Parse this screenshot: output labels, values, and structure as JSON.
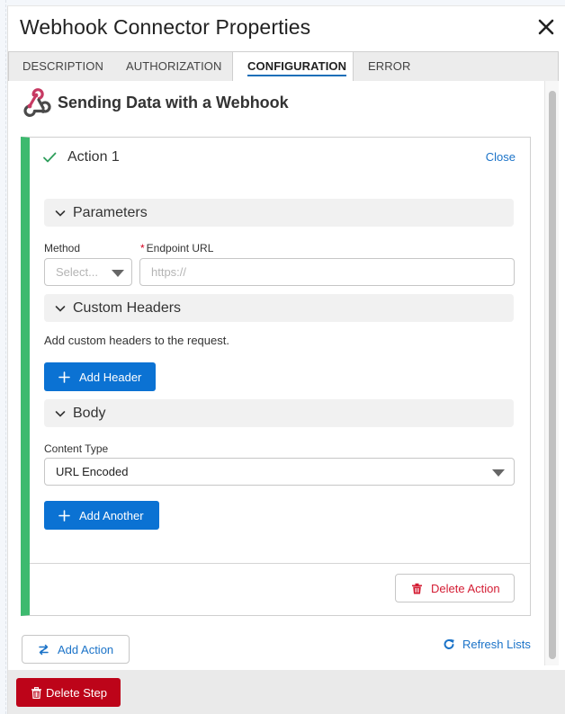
{
  "dialog": {
    "title": "Webhook Connector Properties",
    "close_label": "×"
  },
  "tabs": [
    {
      "label": "DESCRIPTION",
      "active": false
    },
    {
      "label": "AUTHORIZATION",
      "active": false
    },
    {
      "label": "CONFIGURATION",
      "active": true
    },
    {
      "label": "ERROR HANDLING",
      "active": false
    }
  ],
  "section": {
    "title": "Sending Data with a Webhook",
    "icon": "webhook-icon"
  },
  "action": {
    "title": "Action 1",
    "status_icon": "check-icon",
    "close_label": "Close",
    "parameters": {
      "header": "Parameters",
      "method_label": "Method",
      "method_placeholder": "Select...",
      "endpoint_label": "Endpoint URL",
      "endpoint_required": "*",
      "endpoint_placeholder": "https://"
    },
    "custom_headers": {
      "header": "Custom Headers",
      "help": "Add custom headers to the request.",
      "add_button": "Add Header"
    },
    "body": {
      "header": "Body",
      "content_type_label": "Content Type",
      "content_type_value": "URL Encoded",
      "add_button": "Add Another"
    },
    "delete_button": "Delete Action"
  },
  "bottom": {
    "add_action": "Add Action",
    "refresh_lists": "Refresh Lists"
  },
  "footer": {
    "delete_step": "Delete Step"
  },
  "colors": {
    "accent_blue": "#0b72d3",
    "link_blue": "#1b73c8",
    "success_green": "#3dba6f",
    "danger_red": "#d41d34",
    "delete_step_red": "#bd0419",
    "webhook_pink": "#c73a63"
  }
}
